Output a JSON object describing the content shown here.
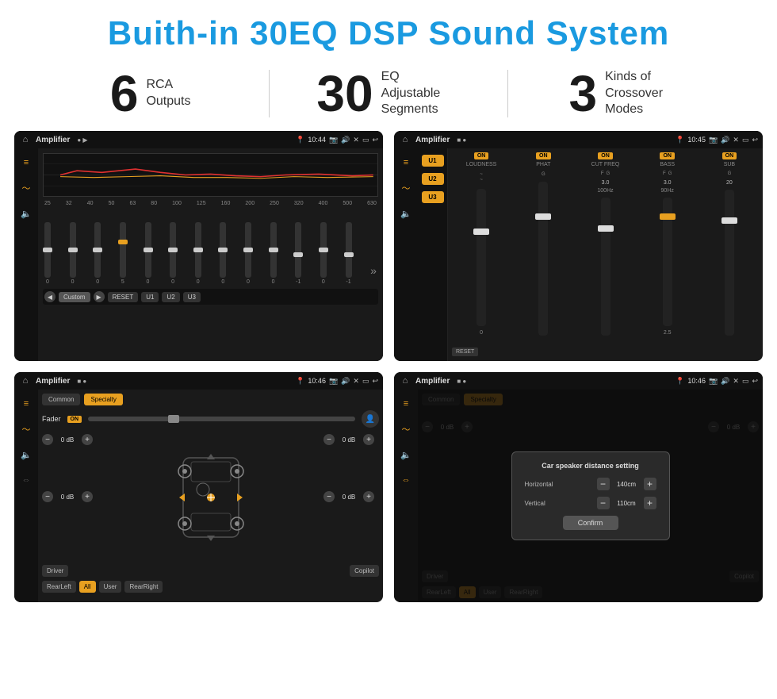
{
  "page": {
    "title": "Buith-in 30EQ DSP Sound System",
    "bg_color": "#ffffff"
  },
  "stats": [
    {
      "number": "6",
      "text_line1": "RCA",
      "text_line2": "Outputs"
    },
    {
      "number": "30",
      "text_line1": "EQ Adjustable",
      "text_line2": "Segments"
    },
    {
      "number": "3",
      "text_line1": "Kinds of",
      "text_line2": "Crossover Modes"
    }
  ],
  "screens": [
    {
      "id": "screen1",
      "status_bar": {
        "title": "Amplifier",
        "time": "10:44",
        "indicator": "● ▶"
      },
      "type": "eq",
      "freq_labels": [
        "25",
        "32",
        "40",
        "50",
        "63",
        "80",
        "100",
        "125",
        "160",
        "200",
        "250",
        "320",
        "400",
        "500",
        "630"
      ],
      "slider_values": [
        "0",
        "0",
        "0",
        "5",
        "0",
        "0",
        "0",
        "0",
        "0",
        "0",
        "-1",
        "0",
        "-1"
      ],
      "preset_label": "Custom",
      "buttons": [
        "RESET",
        "U1",
        "U2",
        "U3"
      ]
    },
    {
      "id": "screen2",
      "status_bar": {
        "title": "Amplifier",
        "time": "10:45",
        "indicator": "■ ●"
      },
      "type": "amp2",
      "presets": [
        "U1",
        "U2",
        "U3"
      ],
      "controls": [
        {
          "name": "LOUDNESS",
          "on": true
        },
        {
          "name": "PHAT",
          "on": true
        },
        {
          "name": "CUT FREQ",
          "on": true
        },
        {
          "name": "BASS",
          "on": true
        },
        {
          "name": "SUB",
          "on": true
        }
      ],
      "reset_label": "RESET"
    },
    {
      "id": "screen3",
      "status_bar": {
        "title": "Amplifier",
        "time": "10:46",
        "indicator": "■ ●"
      },
      "type": "fader",
      "tabs": [
        "Common",
        "Specialty"
      ],
      "active_tab": 1,
      "fader_label": "Fader",
      "fader_on": "ON",
      "db_values": [
        "0 dB",
        "0 dB",
        "0 dB",
        "0 dB"
      ],
      "bottom_buttons": [
        "Driver",
        "",
        "Copilot",
        "RearLeft",
        "All",
        "User",
        "RearRight"
      ],
      "all_active": true
    },
    {
      "id": "screen4",
      "status_bar": {
        "title": "Amplifier",
        "time": "10:46",
        "indicator": "■ ●"
      },
      "type": "fader_dialog",
      "tabs": [
        "Common",
        "Specialty"
      ],
      "active_tab": 1,
      "dialog": {
        "title": "Car speaker distance setting",
        "fields": [
          {
            "label": "Horizontal",
            "value": "140cm"
          },
          {
            "label": "Vertical",
            "value": "110cm"
          }
        ],
        "confirm_label": "Confirm"
      },
      "db_values": [
        "0 dB",
        "0 dB"
      ],
      "bottom_buttons": [
        "Driver",
        "Copilot",
        "RearLeft",
        "User",
        "RearRight"
      ]
    }
  ]
}
